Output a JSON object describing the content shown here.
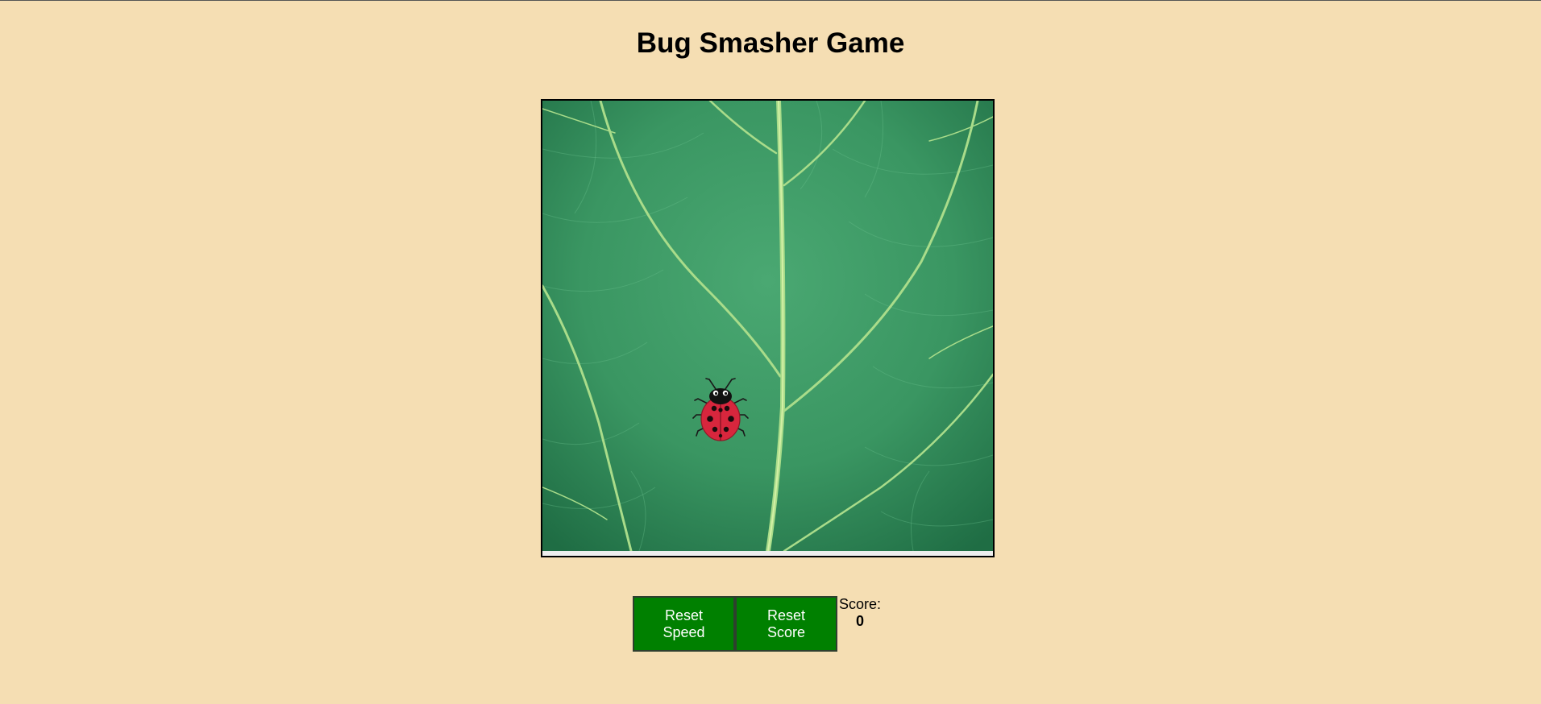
{
  "title": "Bug Smasher Game",
  "buttons": {
    "reset_speed": "Reset Speed",
    "reset_score": "Reset Score"
  },
  "score": {
    "label": "Score:",
    "value": "0"
  },
  "colors": {
    "background": "#f5deb3",
    "button": "#008000",
    "leaf": "#2e8b57",
    "bug_shell": "#d7263d"
  },
  "icons": {
    "bug": "ladybug-icon",
    "board": "leaf-background"
  }
}
